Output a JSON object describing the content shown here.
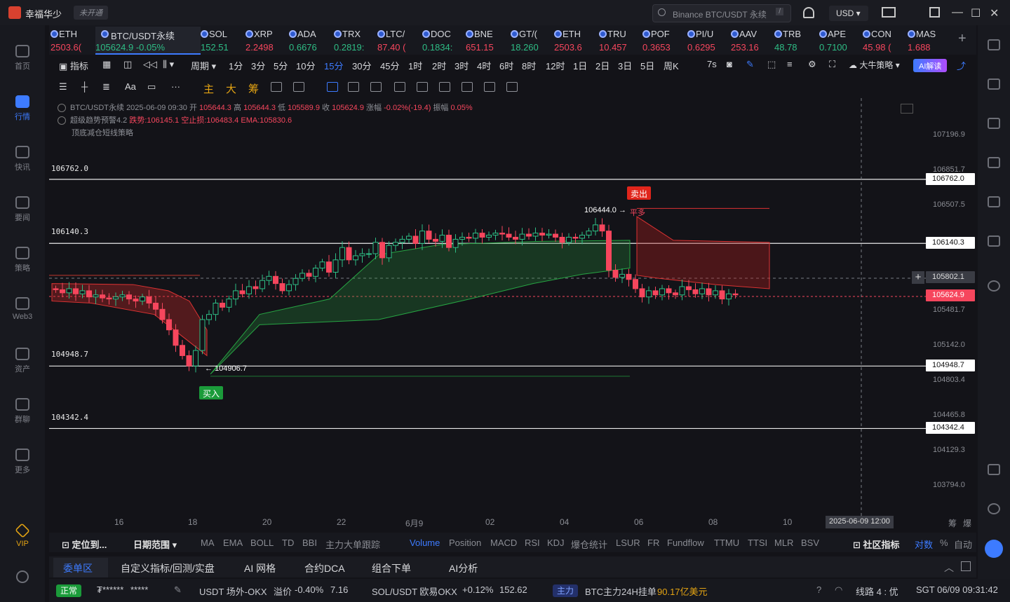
{
  "app": {
    "name": "幸福华少",
    "not_open": "未开通",
    "search_placeholder": "Binance BTC/USDT 永续",
    "search_key": "/",
    "currency": "USD"
  },
  "sidebar": [
    {
      "label": "首页"
    },
    {
      "label": "行情"
    },
    {
      "label": "快讯"
    },
    {
      "label": "要闻"
    },
    {
      "label": "策略"
    },
    {
      "label": "Web3"
    },
    {
      "label": "资产"
    },
    {
      "label": "群聊"
    },
    {
      "label": "更多"
    },
    {
      "label": "VIP"
    }
  ],
  "tickers": [
    {
      "name": "ETH",
      "price": "2503.6(",
      "dir": "dn"
    },
    {
      "name": "BTC/USDT永续",
      "price": "105624.9 -0.05%",
      "dir": "up"
    },
    {
      "name": "SOL",
      "price": "152.51",
      "dir": "up"
    },
    {
      "name": "XRP",
      "price": "2.2498",
      "dir": "dn"
    },
    {
      "name": "ADA",
      "price": "0.6676",
      "dir": "up"
    },
    {
      "name": "TRX",
      "price": "0.2819:",
      "dir": "up"
    },
    {
      "name": "LTC/",
      "price": "87.40 (",
      "dir": "dn"
    },
    {
      "name": "DOC",
      "price": "0.1834:",
      "dir": "up"
    },
    {
      "name": "BNE",
      "price": "651.15",
      "dir": "dn"
    },
    {
      "name": "GT/(",
      "price": "18.260",
      "dir": "up"
    },
    {
      "name": "ETH",
      "price": "2503.6",
      "dir": "dn"
    },
    {
      "name": "TRU",
      "price": "10.457",
      "dir": "dn"
    },
    {
      "name": "POF",
      "price": "0.3653",
      "dir": "dn"
    },
    {
      "name": "PI/U",
      "price": "0.6295",
      "dir": "dn"
    },
    {
      "name": "AAV",
      "price": "253.16",
      "dir": "dn"
    },
    {
      "name": "TRB",
      "price": "48.78",
      "dir": "up"
    },
    {
      "name": "APE",
      "price": "0.7100",
      "dir": "up"
    },
    {
      "name": "CON",
      "price": "45.98 (",
      "dir": "dn"
    },
    {
      "name": "MAS",
      "price": "1.688",
      "dir": "dn"
    }
  ],
  "toolbar": {
    "indicator": "指标",
    "period": "周期",
    "intervals": [
      "1分",
      "3分",
      "5分",
      "10分",
      "15分",
      "30分",
      "45分",
      "1时",
      "2时",
      "3时",
      "4时",
      "6时",
      "8时",
      "12时",
      "1日",
      "2日",
      "3日",
      "5日",
      "周K"
    ],
    "active_interval": "15分",
    "replay": "7s",
    "strategy": "大牛策略",
    "ai": "AI解读"
  },
  "drawtools": {
    "main": "主",
    "big": "大",
    "chip": "筹"
  },
  "legend": {
    "line1": {
      "symbol": "BTC/USDT永续",
      "time": "2025-06-09 09:30",
      "open_l": "开",
      "open": "105644.3",
      "high_l": "高",
      "high": "105644.3",
      "low_l": "低",
      "low": "105589.9",
      "close_l": "收",
      "close": "105624.9",
      "chg_l": "涨幅",
      "chg": "-0.02%(-19.4)",
      "amp_l": "振幅",
      "amp": "0.05%"
    },
    "line2": {
      "name": "超级趋势预警4.2",
      "a": "跌势:106145.1",
      "b": "空止损:106483.4",
      "c": "EMA:105830.6"
    },
    "line3": "顶底减仓短线策略"
  },
  "yaxis": [
    "107196.9",
    "106851.7",
    "106507.5",
    "105481.7",
    "105142.0",
    "104803.4",
    "104465.8",
    "104129.3",
    "103794.0"
  ],
  "levels": [
    {
      "label": "106762.0",
      "tag": "106762.0"
    },
    {
      "label": "106140.3",
      "tag": "106140.3"
    },
    {
      "label": "104948.7",
      "tag": "104948.7"
    },
    {
      "label": "104342.4",
      "tag": "104342.4"
    }
  ],
  "crosshair_price": "105802.1",
  "last_price": "105624.9",
  "markers": {
    "sell": "卖出",
    "buy": "买入",
    "high": "106444.0",
    "close_long": "平多",
    "low": "104906.7"
  },
  "xaxis": [
    "16",
    "18",
    "20",
    "22",
    "6月9",
    "02",
    "04",
    "06",
    "08",
    "10"
  ],
  "crosshair_time": "2025-06-09 12:00",
  "xaxis_right": [
    "筹",
    "爆"
  ],
  "indicators": {
    "locate": "定位到...",
    "range": "日期范围",
    "list": [
      "MA",
      "EMA",
      "BOLL",
      "TD",
      "BBI",
      "主力大单跟踪",
      "Volume",
      "Position",
      "MACD",
      "RSI",
      "KDJ",
      "爆仓统计",
      "LSUR",
      "FR",
      "Fundflow",
      "TTMU",
      "TTSI",
      "MLR",
      "BSV"
    ],
    "active": "Volume",
    "community": "社区指标",
    "pair": "对数",
    "pct": "%",
    "auto": "自动"
  },
  "panel_tabs": [
    "委单区",
    "自定义指标/回测/实盘",
    "AI 网格",
    "合约DCA",
    "组合下单",
    "AI分析"
  ],
  "statusbar": {
    "status": "正常",
    "mask1": "₮******",
    "mask2": "*****",
    "usdt": "USDT 场外-OKX",
    "premium_l": "溢价",
    "premium": "-0.40%",
    "premium_val": "7.16",
    "sol": "SOL/USDT 欧易OKX",
    "sol_chg": "+0.12%",
    "sol_price": "152.62",
    "main": "主力",
    "main_text": "BTC主力24H挂单",
    "main_val": "90.17亿美元",
    "line": "线路 4 : 优",
    "time": "SGT 06/09 09:31:42"
  },
  "chart_data": {
    "type": "candlestick",
    "symbol": "BTC/USDT永续",
    "interval": "15分",
    "ylim": [
      103794.0,
      107196.9
    ],
    "last": 105624.9,
    "high_marker": 106444.0,
    "low_marker": 104906.7,
    "support_resistance": [
      106762.0,
      106140.3,
      104948.7,
      104342.4
    ]
  }
}
